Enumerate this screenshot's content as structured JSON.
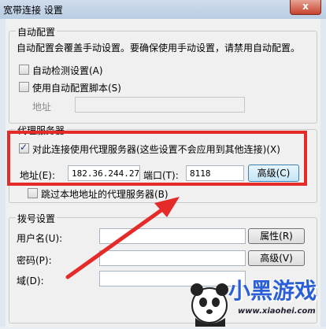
{
  "window": {
    "title": "宽带连接 设置",
    "close_glyph": "x"
  },
  "auto_config": {
    "legend": "自动配置",
    "desc": "自动配置会覆盖手动设置。要确保使用手动设置，请禁用自动配置。",
    "auto_detect_label": "自动检测设置(A)",
    "auto_detect_checked": false,
    "use_script_label": "使用自动配置脚本(S)",
    "use_script_checked": false,
    "address_label": "地址",
    "address_value": ""
  },
  "proxy": {
    "legend": "代理服务器",
    "use_proxy_label": "对此连接使用代理服务器(这些设置不会应用到其他连接)(X)",
    "use_proxy_checked": true,
    "address_label": "地址(E):",
    "address_value": "182.36.244.27",
    "port_label": "端口(T):",
    "port_value": "8118",
    "advanced_button": "高级(C)",
    "bypass_local_label": "跳过本地地址的代理服务器(B)",
    "bypass_local_checked": false
  },
  "dialup": {
    "legend": "拨号设置",
    "username_label": "用户名(U):",
    "username_value": "",
    "properties_button": "属性(R)",
    "password_label": "密码(P):",
    "password_value": "",
    "advanced_button": "高级(V)",
    "domain_label": "域(D):",
    "domain_value": ""
  },
  "watermark": {
    "brand_text": "小黑游戏",
    "url_text": "www.xiaohei.com"
  },
  "colors": {
    "highlight": "#e52a2a",
    "accent": "#3c7fb1",
    "brand": "#2a5fd6"
  }
}
